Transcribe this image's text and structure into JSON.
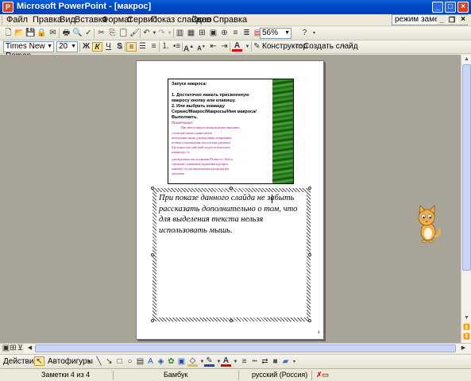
{
  "window": {
    "title": "Microsoft PowerPoint - [макрос]",
    "app_icon_glyph": "P"
  },
  "menu": {
    "items": [
      "Файл",
      "Правка",
      "Вид",
      "Вставка",
      "Формат",
      "Сервис",
      "Показ слайдов",
      "Окно",
      "Справка"
    ],
    "view_mode": "режим заметок:"
  },
  "toolbar": {
    "zoom": "56%",
    "font_name": "Times New Roman",
    "font_size": "20",
    "bold": "Ж",
    "italic": "К",
    "underline": "Ч",
    "shadow": "S",
    "constructor_label": "Конструктор",
    "new_slide_label": "Создать слайд"
  },
  "slide": {
    "heading": "Запуск макроса:",
    "step1_line1": "1. Достаточно нажать присвоенную",
    "step1_line2": "макросу кнопку или клавишу.",
    "step2_line1": "2. Или выбрать команду",
    "step2_line2": "Сервис/Макрос/Макросы/Имя макроса/",
    "step2_line3": "Выполнить.",
    "note_label": "Примечание:",
    "small_lines": [
      "При записи макроса команды можно выполнять",
      "с помощью мыши, однако нельзя",
      "использовать мышь для выделения, копирования,",
      "вставки и перемещения текста в окне документа.",
      "Для записи этих действий следует использовать",
      "клавиатуру, т.е.",
      "для выделения текста клавиши F8 вместе с Shift и",
      "стрелками с клавишами управления курсором;",
      "клавишу Ctrl для перемещения курсора внутри",
      "документа."
    ]
  },
  "notes": {
    "text": "При показе данного слайда не забыть рассказать дополнительно о том, что для выделения текста нельзя использовать мышь."
  },
  "page_number": "4",
  "drawing": {
    "actions_label": "Действия",
    "autoshapes_label": "Автофигуры"
  },
  "status": {
    "notes_count": "Заметки 4 из 4",
    "design": "Бамбук",
    "language": "русский (Россия)"
  }
}
